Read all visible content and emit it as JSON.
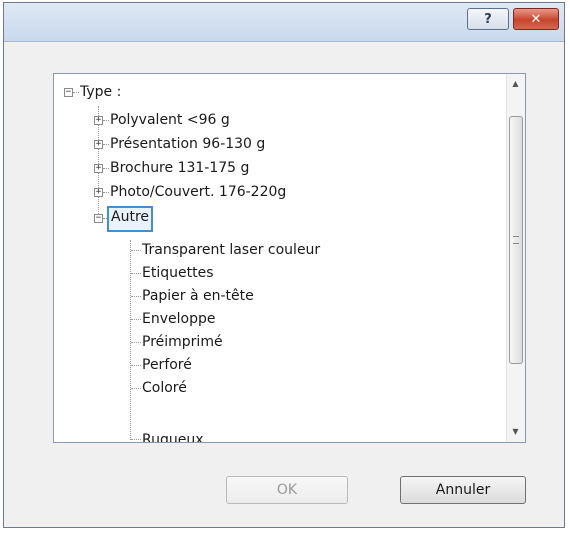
{
  "titlebar": {
    "help_label": "?",
    "close_label": "✕"
  },
  "tree": {
    "root": {
      "label": "Type :",
      "expander": "−"
    },
    "categories": [
      {
        "label": "Polyvalent <96 g",
        "expander": "+"
      },
      {
        "label": "Présentation 96-130 g",
        "expander": "+"
      },
      {
        "label": "Brochure 131-175 g",
        "expander": "+"
      },
      {
        "label": "Photo/Couvert. 176-220g",
        "expander": "+"
      },
      {
        "label": "Autre",
        "expander": "−",
        "selected": true
      }
    ],
    "autre_children": [
      "Transparent laser couleur",
      "Etiquettes",
      "Papier à en-tête",
      "Enveloppe",
      "Préimprimé",
      "Perforé",
      "Coloré",
      "Rugueux"
    ]
  },
  "scrollbar": {
    "up_arrow_icon": "triangle-up",
    "down_arrow_icon": "triangle-down",
    "position_fraction": 0.0
  },
  "buttons": {
    "ok_label": "OK",
    "ok_enabled": false,
    "cancel_label": "Annuler"
  },
  "colors": {
    "selection_border": "#3e8fd6",
    "close_button": "#c7452c"
  }
}
